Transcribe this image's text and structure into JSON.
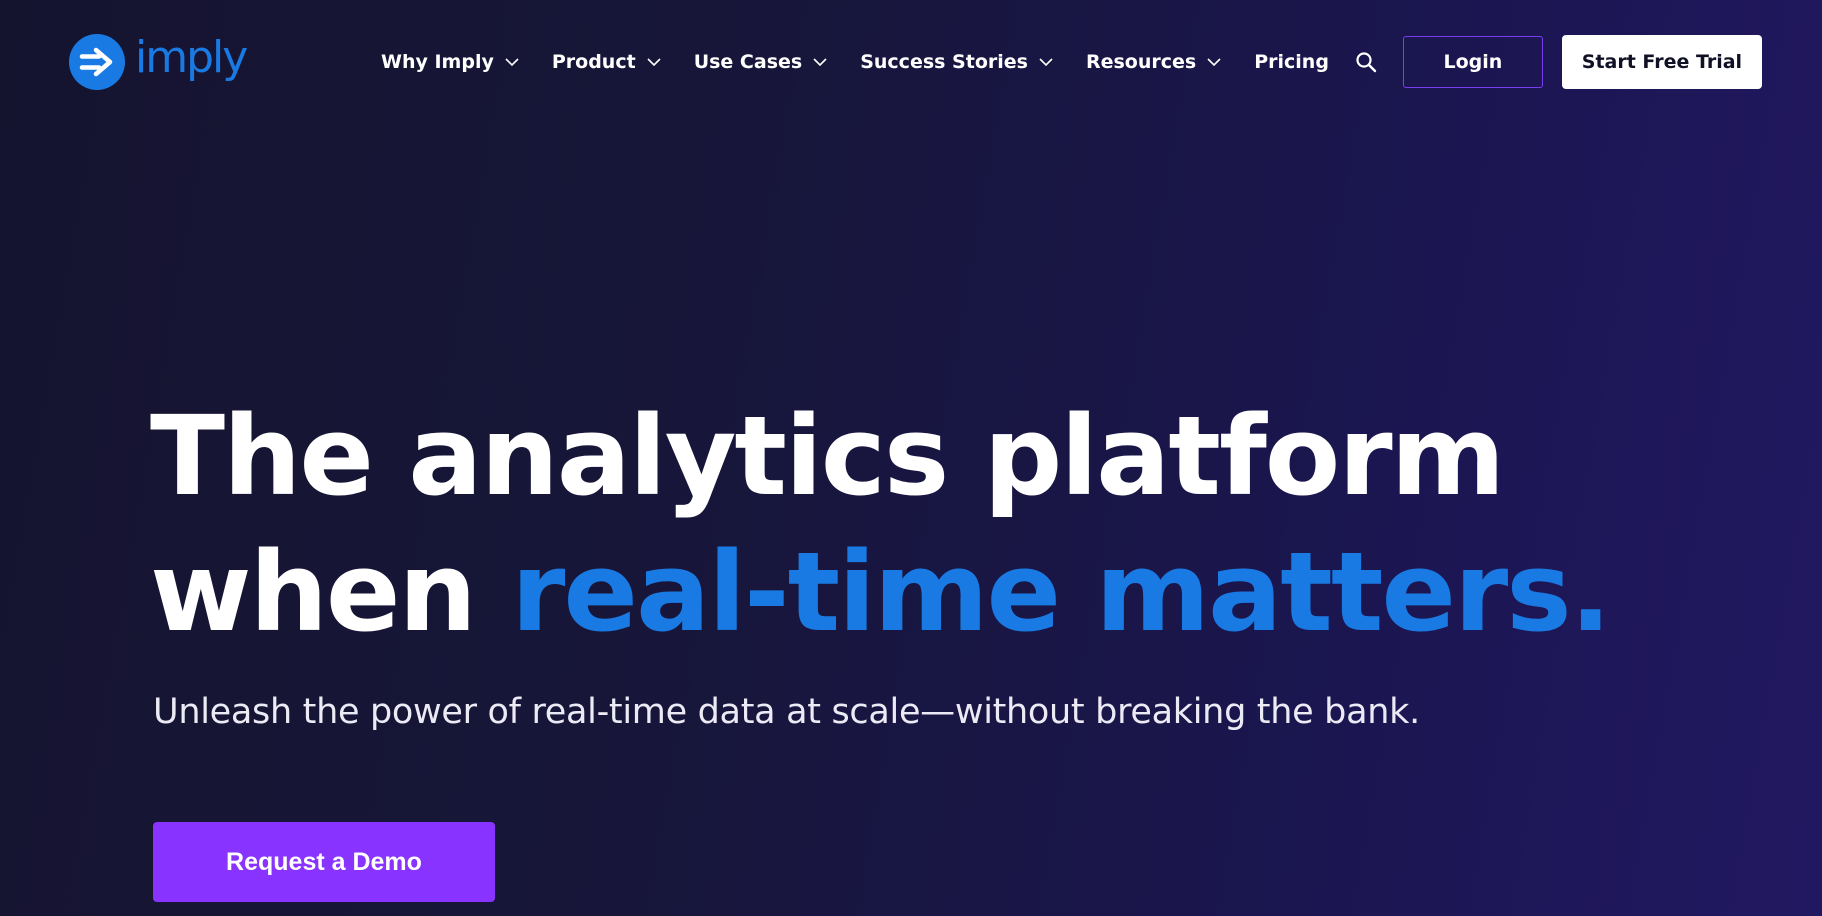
{
  "brand": {
    "name": "imply",
    "logo_icon": "arrow-right-circle-icon",
    "color": "#1a7ae4"
  },
  "nav": {
    "items": [
      {
        "label": "Why Imply",
        "has_dropdown": true
      },
      {
        "label": "Product",
        "has_dropdown": true
      },
      {
        "label": "Use Cases",
        "has_dropdown": true
      },
      {
        "label": "Success Stories",
        "has_dropdown": true
      },
      {
        "label": "Resources",
        "has_dropdown": true
      },
      {
        "label": "Pricing",
        "has_dropdown": false
      }
    ],
    "search_icon": "search-icon",
    "login_label": "Login",
    "trial_label": "Start Free Trial"
  },
  "hero": {
    "title_part1": "The analytics platform",
    "title_part2": "when ",
    "title_accent": "real-time matters.",
    "subtitle": "Unleash the power of real-time data at scale—without breaking the bank.",
    "cta_label": "Request a Demo"
  },
  "colors": {
    "accent_blue": "#1a7ae4",
    "cta_purple": "#8833ff",
    "login_border": "#7b3df0",
    "background": "#17163a"
  }
}
